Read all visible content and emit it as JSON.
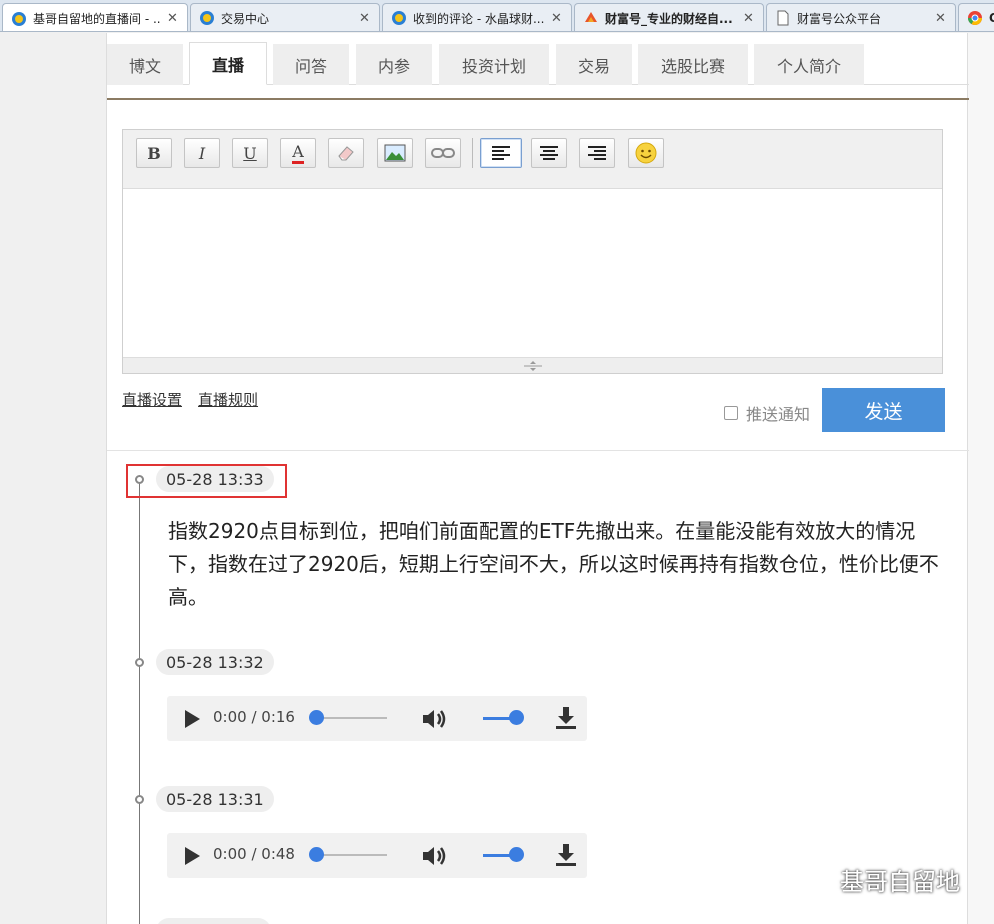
{
  "browser": {
    "tabs": [
      {
        "title": "基哥自留地的直播间 - ...",
        "favicon": "ie-icon",
        "active": true
      },
      {
        "title": "交易中心",
        "favicon": "ie-icon",
        "active": false
      },
      {
        "title": "收到的评论 - 水晶球财...",
        "favicon": "ie-icon",
        "active": false
      },
      {
        "title": "财富号_专业的财经自...",
        "favicon": "caifuhao-icon",
        "active": false
      },
      {
        "title": "财富号公众平台",
        "favicon": "page-icon",
        "active": false
      },
      {
        "title": "Q",
        "favicon": "chrome-icon",
        "active": false
      }
    ]
  },
  "nav": {
    "tabs": [
      "博文",
      "直播",
      "问答",
      "内参",
      "投资计划",
      "交易",
      "选股比赛",
      "个人简介"
    ],
    "active": "直播"
  },
  "toolbar": {
    "bold": "B",
    "italic": "I",
    "underline": "U",
    "font_color": "A"
  },
  "links": {
    "settings": "直播设置",
    "rules": "直播规则"
  },
  "push_label": "推送通知",
  "send_label": "发送",
  "posts": [
    {
      "time": "05-28 13:33",
      "text": "指数2920点目标到位，把咱们前面配置的ETF先撤出来。在量能没能有效放大的情况下，指数在过了2920后，短期上行空间不大，所以这时候再持有指数仓位，性价比便不高。"
    },
    {
      "time": "05-28 13:32",
      "audio_time": "0:00 / 0:16"
    },
    {
      "time": "05-28 13:31",
      "audio_time": "0:00 / 0:48"
    }
  ],
  "watermark": "基哥自留地",
  "colors": {
    "accent": "#4a90d9",
    "highlight": "#e03333",
    "nav_line": "#8b7b63"
  }
}
